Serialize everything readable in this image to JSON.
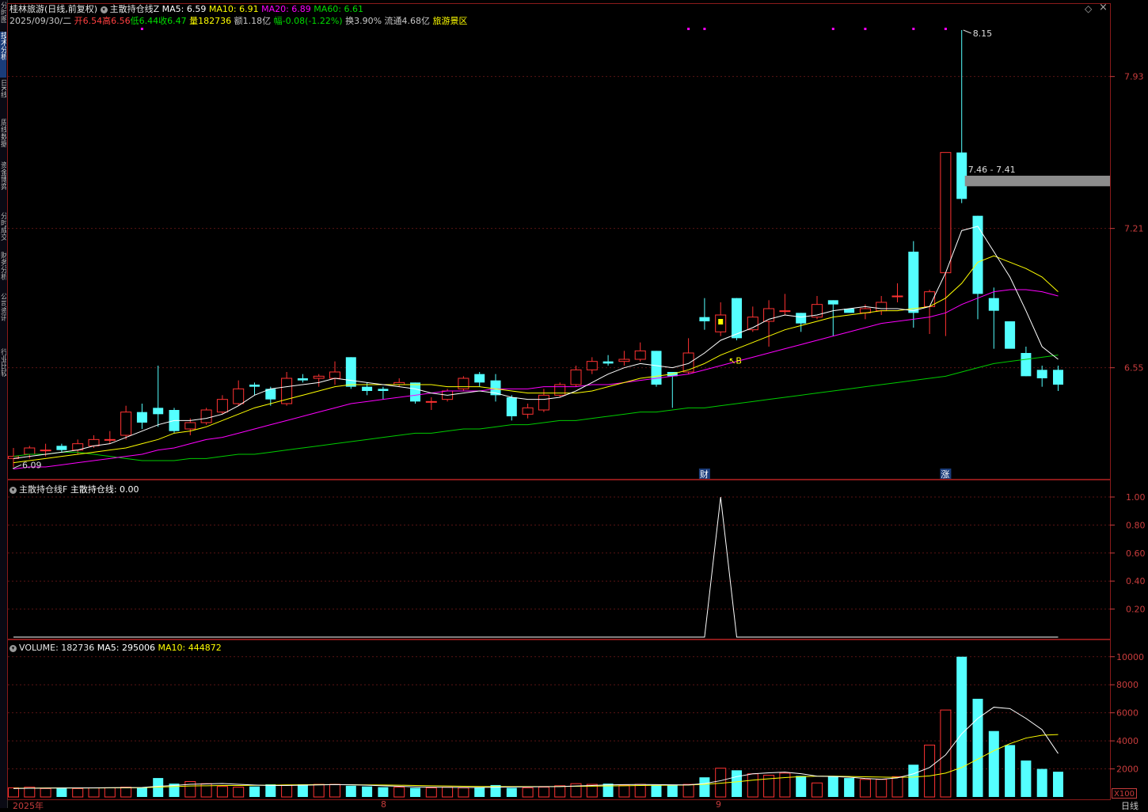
{
  "stock": {
    "name": "桂林旅游",
    "mode": "(日线,前复权)",
    "date": "2025/09/30/二",
    "open_lbl": "开6.54",
    "high_lbl": "高6.56",
    "low_lbl": "低6.44",
    "close_lbl": "收6.47",
    "vol_lbl": "量182736",
    "amount_lbl": "额1.18亿",
    "change_lbl": "幅-0.08(-1.22%)",
    "turnover_lbl": "换3.90%",
    "float_lbl": "流通4.68亿",
    "sector_lbl": "旅游景区"
  },
  "main_panel": {
    "indicator_name": "主散持仓线Z",
    "ma5": "MA5: 6.59",
    "ma10": "MA10: 6.91",
    "ma20": "MA20: 6.89",
    "ma60": "MA60: 6.61",
    "price_high_label": "8.15",
    "price_low_label": "6.09",
    "range_label": "7.46 - 7.41",
    "signal_label": "B",
    "event_cai": "财",
    "event_zhang": "涨"
  },
  "indicator_panel": {
    "title": "主散持仓线F",
    "line_label": "主散持仓线: 0.00"
  },
  "volume_panel": {
    "vol": "VOLUME: 182736",
    "ma5": "MA5: 295006",
    "ma10": "MA10: 444872",
    "unit": "X100"
  },
  "x_axis": {
    "start": "2025年",
    "mark1": "8",
    "mark2": "9",
    "period": "日线"
  },
  "left_tabs": [
    "分时图",
    "技术分析",
    "日K线",
    "周线数据",
    "资金博弈",
    "分时成交",
    "财务分析",
    "公司资讯",
    "行业比较"
  ],
  "colors": {
    "up": "#ff3232",
    "down": "#54ffff",
    "ma5": "#ffffff",
    "ma10": "#ffff00",
    "ma20": "#ff00ff",
    "ma60": "#00cc00",
    "frame": "#8a1a1a",
    "scale_text": "#c83c3c"
  },
  "chart_data": {
    "type": "candlestick",
    "price_axis": {
      "ticks": [
        7.93,
        7.21,
        6.55
      ],
      "tick_labels": [
        "7.93",
        "7.21",
        "6.55"
      ],
      "range": [
        6.05,
        8.18
      ]
    },
    "candles": [
      {
        "o": 6.12,
        "h": 6.17,
        "l": 6.08,
        "c": 6.13
      },
      {
        "o": 6.14,
        "h": 6.18,
        "l": 6.12,
        "c": 6.17
      },
      {
        "o": 6.16,
        "h": 6.19,
        "l": 6.13,
        "c": 6.16
      },
      {
        "o": 6.18,
        "h": 6.19,
        "l": 6.15,
        "c": 6.16
      },
      {
        "o": 6.16,
        "h": 6.21,
        "l": 6.14,
        "c": 6.19
      },
      {
        "o": 6.18,
        "h": 6.23,
        "l": 6.17,
        "c": 6.21
      },
      {
        "o": 6.21,
        "h": 6.25,
        "l": 6.19,
        "c": 6.21
      },
      {
        "o": 6.23,
        "h": 6.37,
        "l": 6.21,
        "c": 6.34
      },
      {
        "o": 6.34,
        "h": 6.38,
        "l": 6.26,
        "c": 6.29
      },
      {
        "o": 6.36,
        "h": 6.56,
        "l": 6.27,
        "c": 6.33
      },
      {
        "o": 6.35,
        "h": 6.36,
        "l": 6.24,
        "c": 6.25
      },
      {
        "o": 6.26,
        "h": 6.31,
        "l": 6.23,
        "c": 6.29
      },
      {
        "o": 6.29,
        "h": 6.36,
        "l": 6.28,
        "c": 6.35
      },
      {
        "o": 6.34,
        "h": 6.42,
        "l": 6.33,
        "c": 6.4
      },
      {
        "o": 6.38,
        "h": 6.49,
        "l": 6.37,
        "c": 6.45
      },
      {
        "o": 6.47,
        "h": 6.48,
        "l": 6.42,
        "c": 6.46
      },
      {
        "o": 6.45,
        "h": 6.46,
        "l": 6.37,
        "c": 6.4
      },
      {
        "o": 6.38,
        "h": 6.53,
        "l": 6.37,
        "c": 6.5
      },
      {
        "o": 6.5,
        "h": 6.52,
        "l": 6.48,
        "c": 6.49
      },
      {
        "o": 6.5,
        "h": 6.52,
        "l": 6.46,
        "c": 6.51
      },
      {
        "o": 6.5,
        "h": 6.58,
        "l": 6.47,
        "c": 6.53
      },
      {
        "o": 6.6,
        "h": 6.6,
        "l": 6.45,
        "c": 6.46
      },
      {
        "o": 6.46,
        "h": 6.48,
        "l": 6.42,
        "c": 6.44
      },
      {
        "o": 6.45,
        "h": 6.46,
        "l": 6.4,
        "c": 6.44
      },
      {
        "o": 6.47,
        "h": 6.5,
        "l": 6.46,
        "c": 6.48
      },
      {
        "o": 6.48,
        "h": 6.48,
        "l": 6.38,
        "c": 6.39
      },
      {
        "o": 6.39,
        "h": 6.41,
        "l": 6.35,
        "c": 6.39
      },
      {
        "o": 6.4,
        "h": 6.45,
        "l": 6.39,
        "c": 6.44
      },
      {
        "o": 6.45,
        "h": 6.51,
        "l": 6.44,
        "c": 6.5
      },
      {
        "o": 6.52,
        "h": 6.53,
        "l": 6.46,
        "c": 6.48
      },
      {
        "o": 6.49,
        "h": 6.52,
        "l": 6.39,
        "c": 6.42
      },
      {
        "o": 6.41,
        "h": 6.42,
        "l": 6.3,
        "c": 6.32
      },
      {
        "o": 6.33,
        "h": 6.38,
        "l": 6.31,
        "c": 6.36
      },
      {
        "o": 6.35,
        "h": 6.45,
        "l": 6.34,
        "c": 6.42
      },
      {
        "o": 6.42,
        "h": 6.48,
        "l": 6.41,
        "c": 6.47
      },
      {
        "o": 6.47,
        "h": 6.56,
        "l": 6.46,
        "c": 6.54
      },
      {
        "o": 6.54,
        "h": 6.6,
        "l": 6.52,
        "c": 6.58
      },
      {
        "o": 6.58,
        "h": 6.61,
        "l": 6.56,
        "c": 6.57
      },
      {
        "o": 6.58,
        "h": 6.63,
        "l": 6.56,
        "c": 6.59
      },
      {
        "o": 6.59,
        "h": 6.67,
        "l": 6.58,
        "c": 6.63
      },
      {
        "o": 6.63,
        "h": 6.63,
        "l": 6.46,
        "c": 6.47
      },
      {
        "o": 6.53,
        "h": 6.53,
        "l": 6.36,
        "c": 6.51
      },
      {
        "o": 6.53,
        "h": 6.69,
        "l": 6.52,
        "c": 6.62
      },
      {
        "o": 6.79,
        "h": 6.88,
        "l": 6.73,
        "c": 6.77
      },
      {
        "o": 6.72,
        "h": 6.86,
        "l": 6.7,
        "c": 6.8
      },
      {
        "o": 6.88,
        "h": 6.88,
        "l": 6.68,
        "c": 6.69
      },
      {
        "o": 6.73,
        "h": 6.84,
        "l": 6.72,
        "c": 6.79
      },
      {
        "o": 6.77,
        "h": 6.87,
        "l": 6.65,
        "c": 6.83
      },
      {
        "o": 6.82,
        "h": 6.9,
        "l": 6.8,
        "c": 6.82
      },
      {
        "o": 6.81,
        "h": 6.81,
        "l": 6.72,
        "c": 6.76
      },
      {
        "o": 6.79,
        "h": 6.89,
        "l": 6.78,
        "c": 6.85
      },
      {
        "o": 6.87,
        "h": 6.87,
        "l": 6.7,
        "c": 6.85
      },
      {
        "o": 6.83,
        "h": 6.83,
        "l": 6.82,
        "c": 6.81
      },
      {
        "o": 6.81,
        "h": 6.85,
        "l": 6.78,
        "c": 6.83
      },
      {
        "o": 6.82,
        "h": 6.89,
        "l": 6.8,
        "c": 6.86
      },
      {
        "o": 6.89,
        "h": 6.95,
        "l": 6.86,
        "c": 6.89
      },
      {
        "o": 7.1,
        "h": 7.15,
        "l": 6.74,
        "c": 6.81
      },
      {
        "o": 6.84,
        "h": 6.92,
        "l": 6.71,
        "c": 6.91
      },
      {
        "o": 7.0,
        "h": 7.57,
        "l": 6.7,
        "c": 7.57
      },
      {
        "o": 7.57,
        "h": 8.15,
        "l": 7.33,
        "c": 7.35
      },
      {
        "o": 7.27,
        "h": 7.27,
        "l": 6.78,
        "c": 6.9
      },
      {
        "o": 6.88,
        "h": 6.93,
        "l": 6.64,
        "c": 6.82
      },
      {
        "o": 6.77,
        "h": 6.77,
        "l": 6.65,
        "c": 6.64
      },
      {
        "o": 6.62,
        "h": 6.65,
        "l": 6.51,
        "c": 6.51
      },
      {
        "o": 6.54,
        "h": 6.56,
        "l": 6.46,
        "c": 6.5
      },
      {
        "o": 6.54,
        "h": 6.56,
        "l": 6.44,
        "c": 6.47
      }
    ],
    "ma5": [
      6.12,
      6.13,
      6.14,
      6.15,
      6.16,
      6.18,
      6.19,
      6.22,
      6.25,
      6.28,
      6.3,
      6.3,
      6.31,
      6.33,
      6.37,
      6.42,
      6.45,
      6.46,
      6.47,
      6.48,
      6.5,
      6.49,
      6.48,
      6.47,
      6.46,
      6.45,
      6.43,
      6.42,
      6.43,
      6.44,
      6.43,
      6.41,
      6.4,
      6.4,
      6.41,
      6.44,
      6.48,
      6.52,
      6.55,
      6.57,
      6.56,
      6.55,
      6.57,
      6.62,
      6.68,
      6.71,
      6.74,
      6.78,
      6.8,
      6.79,
      6.8,
      6.82,
      6.83,
      6.84,
      6.83,
      6.83,
      6.82,
      6.84,
      7.0,
      7.2,
      7.22,
      7.1,
      6.98,
      6.82,
      6.65,
      6.59
    ],
    "ma10": [
      6.1,
      6.11,
      6.12,
      6.13,
      6.14,
      6.15,
      6.16,
      6.17,
      6.19,
      6.21,
      6.24,
      6.25,
      6.27,
      6.3,
      6.33,
      6.36,
      6.38,
      6.4,
      6.42,
      6.44,
      6.46,
      6.47,
      6.47,
      6.47,
      6.47,
      6.47,
      6.47,
      6.46,
      6.46,
      6.46,
      6.45,
      6.44,
      6.43,
      6.43,
      6.43,
      6.43,
      6.44,
      6.46,
      6.48,
      6.5,
      6.51,
      6.52,
      6.54,
      6.57,
      6.61,
      6.64,
      6.67,
      6.7,
      6.73,
      6.75,
      6.77,
      6.79,
      6.8,
      6.81,
      6.82,
      6.82,
      6.83,
      6.84,
      6.88,
      6.95,
      7.05,
      7.08,
      7.05,
      7.02,
      6.98,
      6.91
    ],
    "ma20": [
      6.07,
      6.08,
      6.08,
      6.09,
      6.1,
      6.11,
      6.12,
      6.13,
      6.14,
      6.16,
      6.17,
      6.19,
      6.21,
      6.22,
      6.24,
      6.26,
      6.28,
      6.3,
      6.32,
      6.34,
      6.36,
      6.38,
      6.39,
      6.4,
      6.41,
      6.42,
      6.43,
      6.44,
      6.44,
      6.44,
      6.45,
      6.45,
      6.45,
      6.46,
      6.46,
      6.46,
      6.47,
      6.47,
      6.48,
      6.49,
      6.5,
      6.51,
      6.52,
      6.54,
      6.56,
      6.58,
      6.6,
      6.62,
      6.64,
      6.66,
      6.68,
      6.7,
      6.72,
      6.74,
      6.76,
      6.77,
      6.78,
      6.79,
      6.81,
      6.85,
      6.88,
      6.91,
      6.92,
      6.92,
      6.91,
      6.89
    ],
    "ma60": [
      6.13,
      6.14,
      6.14,
      6.15,
      6.15,
      6.14,
      6.13,
      6.12,
      6.11,
      6.11,
      6.11,
      6.12,
      6.12,
      6.13,
      6.14,
      6.14,
      6.15,
      6.16,
      6.17,
      6.18,
      6.19,
      6.2,
      6.21,
      6.22,
      6.23,
      6.24,
      6.24,
      6.25,
      6.26,
      6.26,
      6.27,
      6.28,
      6.28,
      6.29,
      6.3,
      6.3,
      6.31,
      6.32,
      6.33,
      6.34,
      6.34,
      6.35,
      6.36,
      6.36,
      6.37,
      6.38,
      6.39,
      6.4,
      6.41,
      6.42,
      6.43,
      6.44,
      6.45,
      6.46,
      6.47,
      6.48,
      6.49,
      6.5,
      6.51,
      6.53,
      6.55,
      6.57,
      6.58,
      6.59,
      6.6,
      6.61
    ],
    "indicator_axis": {
      "ticks": [
        1.0,
        0.8,
        0.6,
        0.4,
        0.2
      ],
      "tick_labels": [
        "1.00",
        "0.80",
        "0.60",
        "0.40",
        "0.20"
      ],
      "range": [
        0,
        1.0
      ]
    },
    "indicator_peak_index": 44,
    "volume_axis": {
      "ticks": [
        10000,
        8000,
        6000,
        4000,
        2000
      ],
      "tick_labels": [
        "10000",
        "8000",
        "6000",
        "4000",
        "2000"
      ],
      "range": [
        0,
        10100
      ]
    },
    "volume": [
      650,
      700,
      600,
      650,
      600,
      650,
      650,
      700,
      650,
      1350,
      950,
      1100,
      950,
      750,
      700,
      750,
      900,
      850,
      900,
      900,
      900,
      800,
      750,
      700,
      700,
      650,
      650,
      700,
      650,
      700,
      850,
      650,
      650,
      700,
      800,
      950,
      900,
      950,
      850,
      900,
      850,
      850,
      900,
      1400,
      2050,
      1900,
      1650,
      1550,
      1700,
      1500,
      1000,
      1500,
      1350,
      1250,
      1250,
      1450,
      2300,
      3700,
      6200,
      10000,
      7000,
      4700,
      3700,
      2600,
      2000,
      1800
    ],
    "volume_ma5": [
      600,
      620,
      630,
      640,
      640,
      650,
      660,
      670,
      680,
      760,
      820,
      900,
      930,
      960,
      900,
      850,
      820,
      820,
      840,
      860,
      880,
      870,
      840,
      800,
      760,
      720,
      700,
      690,
      680,
      680,
      700,
      710,
      720,
      730,
      740,
      780,
      820,
      860,
      880,
      890,
      880,
      870,
      860,
      960,
      1160,
      1450,
      1650,
      1720,
      1770,
      1660,
      1480,
      1460,
      1410,
      1320,
      1260,
      1360,
      1650,
      2100,
      3000,
      4500,
      5600,
      6400,
      6300,
      5600,
      4800,
      3100
    ],
    "volume_ma10": [
      620,
      630,
      640,
      640,
      640,
      640,
      650,
      650,
      660,
      700,
      740,
      780,
      800,
      820,
      820,
      830,
      840,
      860,
      870,
      880,
      880,
      870,
      860,
      850,
      840,
      820,
      800,
      780,
      760,
      750,
      740,
      740,
      740,
      740,
      750,
      760,
      770,
      790,
      800,
      820,
      830,
      840,
      850,
      900,
      980,
      1080,
      1200,
      1300,
      1380,
      1450,
      1480,
      1480,
      1460,
      1440,
      1420,
      1400,
      1420,
      1500,
      1700,
      2100,
      2700,
      3300,
      3800,
      4200,
      4400,
      4448
    ]
  }
}
